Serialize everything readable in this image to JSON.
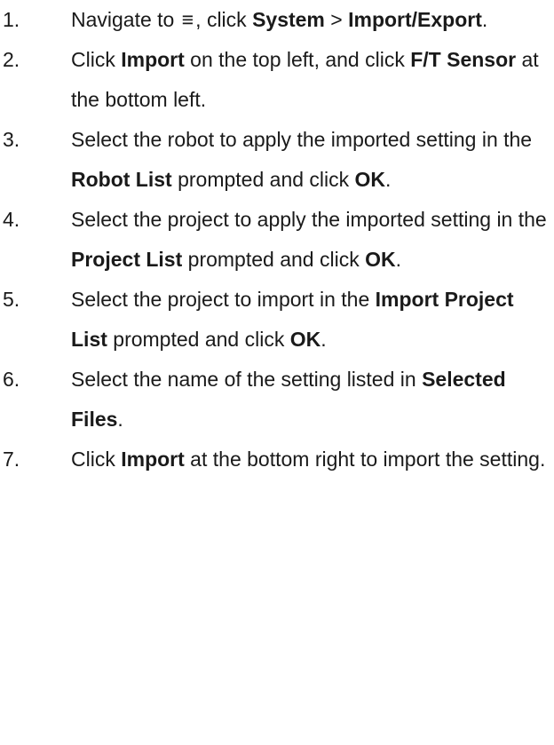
{
  "steps": [
    {
      "number": "1.",
      "parts": [
        {
          "text": "Navigate to ",
          "bold": false
        },
        {
          "text": "≡",
          "bold": false,
          "icon": "menu-icon"
        },
        {
          "text": ", click ",
          "bold": false
        },
        {
          "text": "System",
          "bold": true
        },
        {
          "text": " > ",
          "bold": false
        },
        {
          "text": "Import/Export",
          "bold": true
        },
        {
          "text": ".",
          "bold": false
        }
      ]
    },
    {
      "number": "2.",
      "parts": [
        {
          "text": "Click ",
          "bold": false
        },
        {
          "text": "Import",
          "bold": true
        },
        {
          "text": " on the top left, and click ",
          "bold": false
        },
        {
          "text": "F/T Sensor",
          "bold": true
        },
        {
          "text": " at the bottom left.",
          "bold": false
        }
      ]
    },
    {
      "number": "3.",
      "parts": [
        {
          "text": "Select the robot to apply the imported setting in the ",
          "bold": false
        },
        {
          "text": "Robot List",
          "bold": true
        },
        {
          "text": " prompted and click ",
          "bold": false
        },
        {
          "text": "OK",
          "bold": true
        },
        {
          "text": ".",
          "bold": false
        }
      ]
    },
    {
      "number": "4.",
      "parts": [
        {
          "text": "Select the project to apply the imported setting in the ",
          "bold": false
        },
        {
          "text": "Project List",
          "bold": true
        },
        {
          "text": " prompted and click ",
          "bold": false
        },
        {
          "text": "OK",
          "bold": true
        },
        {
          "text": ".",
          "bold": false
        }
      ]
    },
    {
      "number": "5.",
      "parts": [
        {
          "text": "Select the project to import in the ",
          "bold": false
        },
        {
          "text": "Import Project List",
          "bold": true
        },
        {
          "text": " prompted and click ",
          "bold": false
        },
        {
          "text": "OK",
          "bold": true
        },
        {
          "text": ".",
          "bold": false
        }
      ]
    },
    {
      "number": "6.",
      "parts": [
        {
          "text": "Select the name of the setting listed in ",
          "bold": false
        },
        {
          "text": "Selected Files",
          "bold": true
        },
        {
          "text": ".",
          "bold": false
        }
      ]
    },
    {
      "number": "7.",
      "parts": [
        {
          "text": "Click ",
          "bold": false
        },
        {
          "text": "Import",
          "bold": true
        },
        {
          "text": " at the bottom right to import the setting.",
          "bold": false
        }
      ]
    }
  ]
}
